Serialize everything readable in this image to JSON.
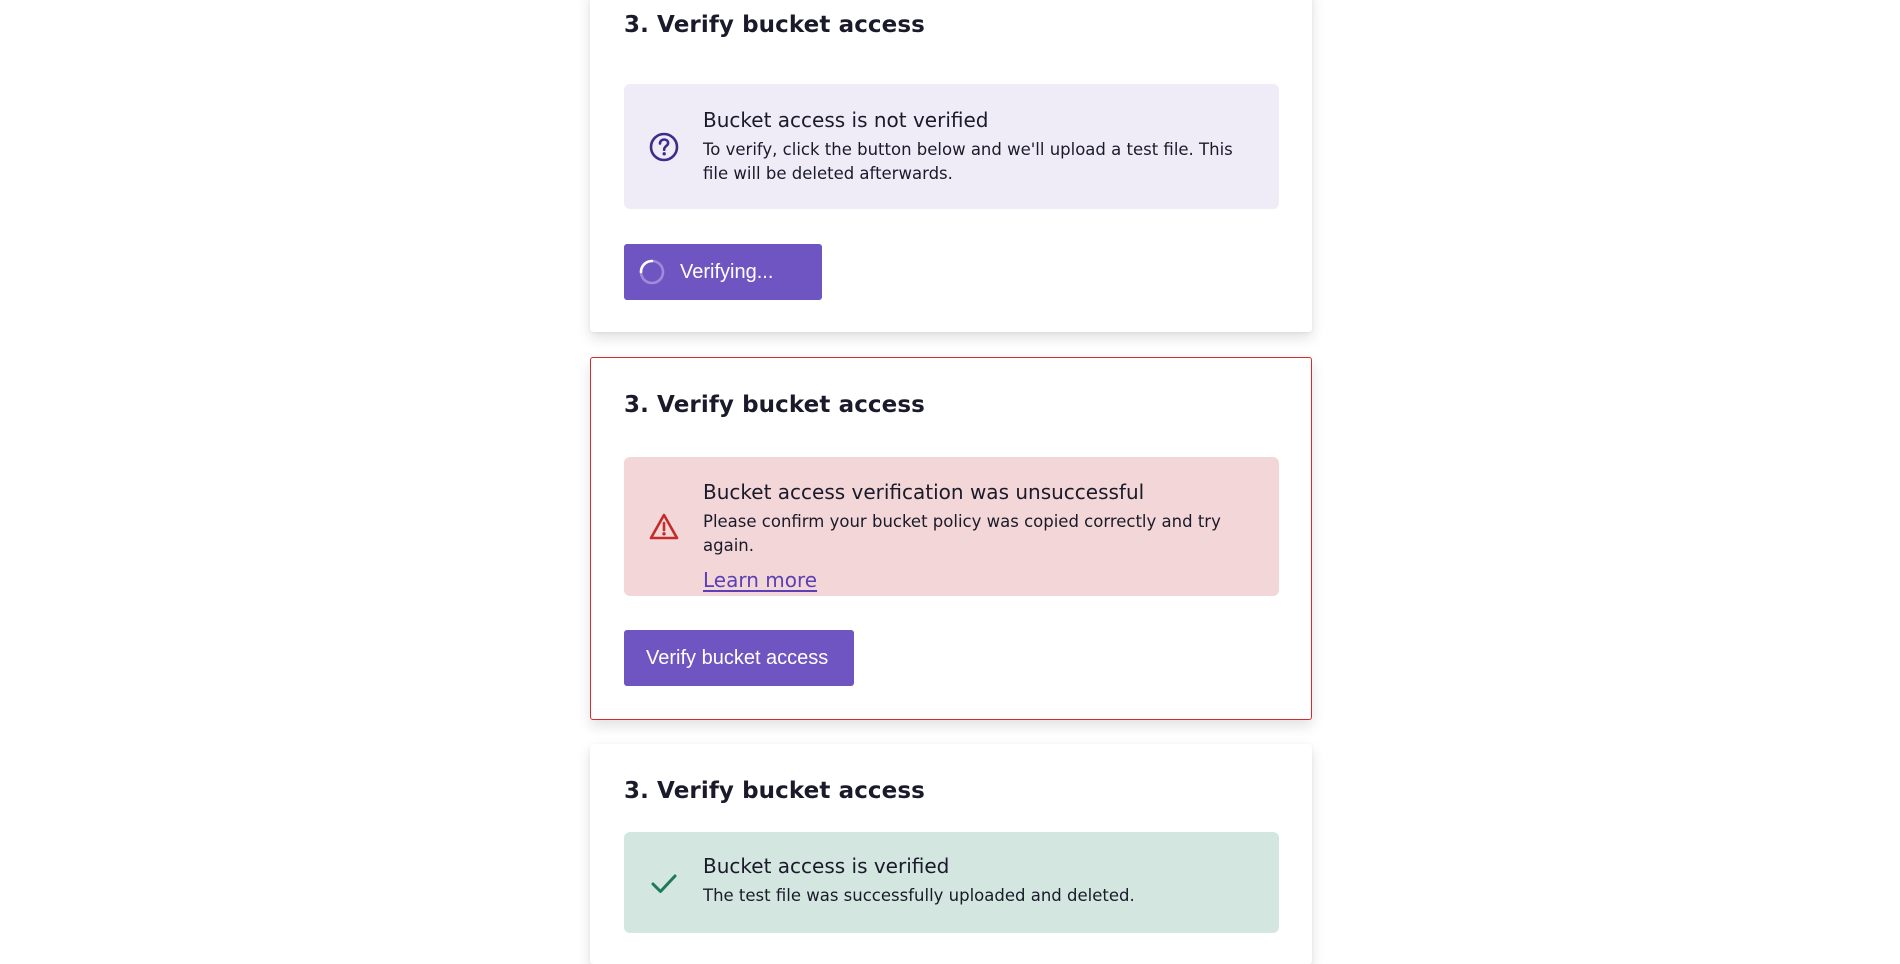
{
  "cards": [
    {
      "heading": "3. Verify bucket access",
      "notice": {
        "icon": "question-circle-icon",
        "title": "Bucket access is not verified",
        "text": "To verify, click the button below and we'll upload a test file. This file will be deleted afterwards."
      },
      "button_label": "Verifying...",
      "button_icon": "spinner-icon"
    },
    {
      "heading": "3. Verify bucket access",
      "notice": {
        "icon": "warning-triangle-icon",
        "title": "Bucket access verification was unsuccessful",
        "text": "Please confirm your bucket policy was copied correctly and try again.",
        "link": "Learn more"
      },
      "button_label": "Verify bucket access"
    },
    {
      "heading": "3. Verify bucket access",
      "notice": {
        "icon": "checkmark-icon",
        "title": "Bucket access is verified",
        "text": "The test file was successfully uploaded and deleted."
      }
    }
  ],
  "colors": {
    "primary": "#6f55c2",
    "info_bg": "#efecf8",
    "danger_bg": "#f3d6d7",
    "danger_border": "#d62b2b",
    "success_bg": "#d3e6e0",
    "success_icon": "#1f7a5a",
    "link": "#5b3fb5"
  }
}
